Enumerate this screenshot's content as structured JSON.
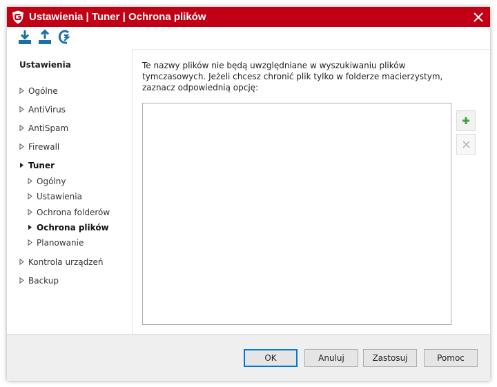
{
  "window": {
    "title": "Ustawienia | Tuner | Ochrona plików",
    "close_glyph": "✕"
  },
  "toolbar": {
    "buttons": [
      {
        "icon": "import-icon"
      },
      {
        "icon": "export-icon"
      },
      {
        "icon": "restore-defaults-icon"
      }
    ]
  },
  "sidebar": {
    "heading": "Ustawienia",
    "items": [
      {
        "label": "Ogólne"
      },
      {
        "label": "AntiVirus"
      },
      {
        "label": "AntiSpam"
      },
      {
        "label": "Firewall"
      },
      {
        "label": "Tuner",
        "expanded": true
      },
      {
        "label": "Ogólny"
      },
      {
        "label": "Ustawienia"
      },
      {
        "label": "Ochrona folderów"
      },
      {
        "label": "Ochrona plików",
        "selected": true
      },
      {
        "label": "Planowanie"
      },
      {
        "label": "Kontrola urządzeń"
      },
      {
        "label": "Backup"
      }
    ]
  },
  "main": {
    "description": "Te nazwy plików nie będą uwzględniane w wyszukiwaniu plików tymczasowych. Jeżeli chcesz chronić plik tylko w folderze macierzystym, zaznacz odpowiednią opcję:",
    "add_icon": "plus-icon",
    "remove_icon": "x-icon"
  },
  "footer": {
    "ok": "OK",
    "cancel": "Anuluj",
    "apply": "Zastosuj",
    "help": "Pomoc"
  },
  "colors": {
    "titlebar": "#c10016",
    "toolbar_icons": "#1d6fa8",
    "add_icon": "#3aa43a",
    "default_button_border": "#0078d7"
  }
}
